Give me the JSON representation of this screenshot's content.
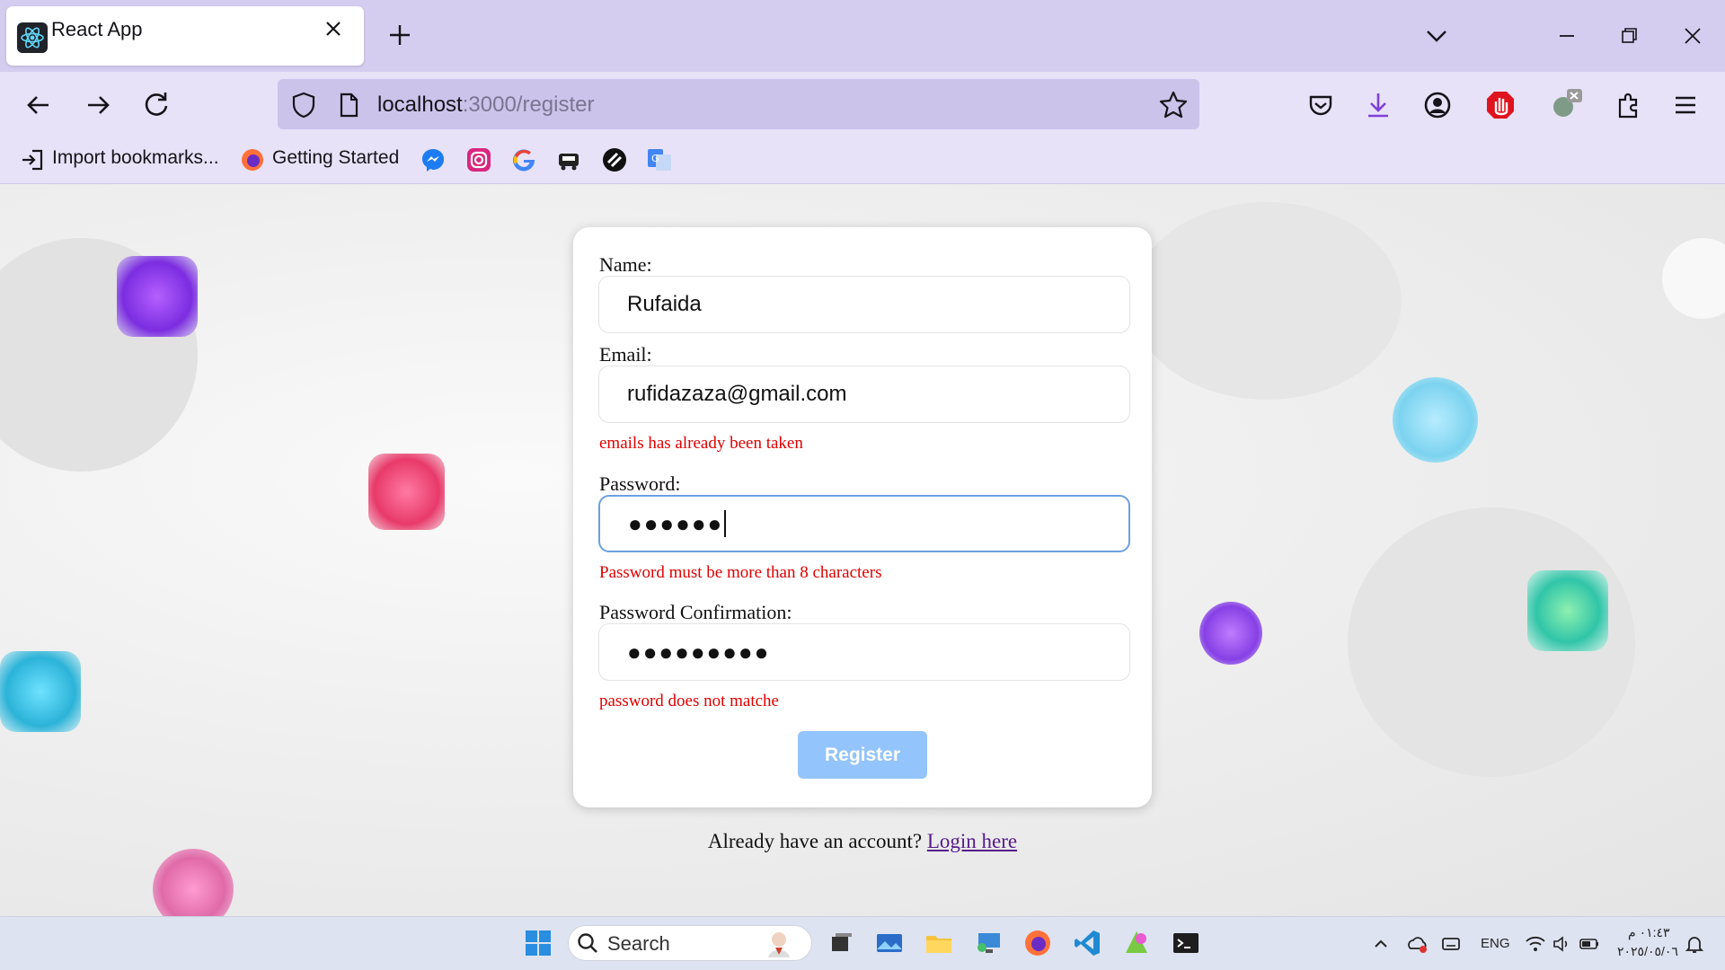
{
  "browser": {
    "tab_title": "React App",
    "url_host": "localhost",
    "url_path": ":3000/register",
    "bookmarks": [
      {
        "label": "Import bookmarks..."
      },
      {
        "label": "Getting Started"
      }
    ]
  },
  "form": {
    "name_label": "Name:",
    "name_value": "Rufaida",
    "email_label": "Email:",
    "email_value": "rufidazaza@gmail.com",
    "email_error": "emails has already been taken",
    "password_label": "Password:",
    "password_value": "●●●●●●",
    "password_error": "Password must be more than 8 characters",
    "confirm_label": "Password Confirmation:",
    "confirm_value": "●●●●●●●●●",
    "confirm_error": "password does not matche",
    "register_label": "Register",
    "login_prompt": "Already have an account?",
    "login_link": "Login here"
  },
  "taskbar": {
    "search_label": "Search",
    "language": "ENG",
    "time": "٠١:٤٣ م",
    "date": "٢٠٢٥/٠٥/٠٦"
  },
  "colors": {
    "tabbar": "#d5cdf0",
    "error": "#e00000",
    "button": "#93c4fb",
    "link": "#551a8b"
  }
}
